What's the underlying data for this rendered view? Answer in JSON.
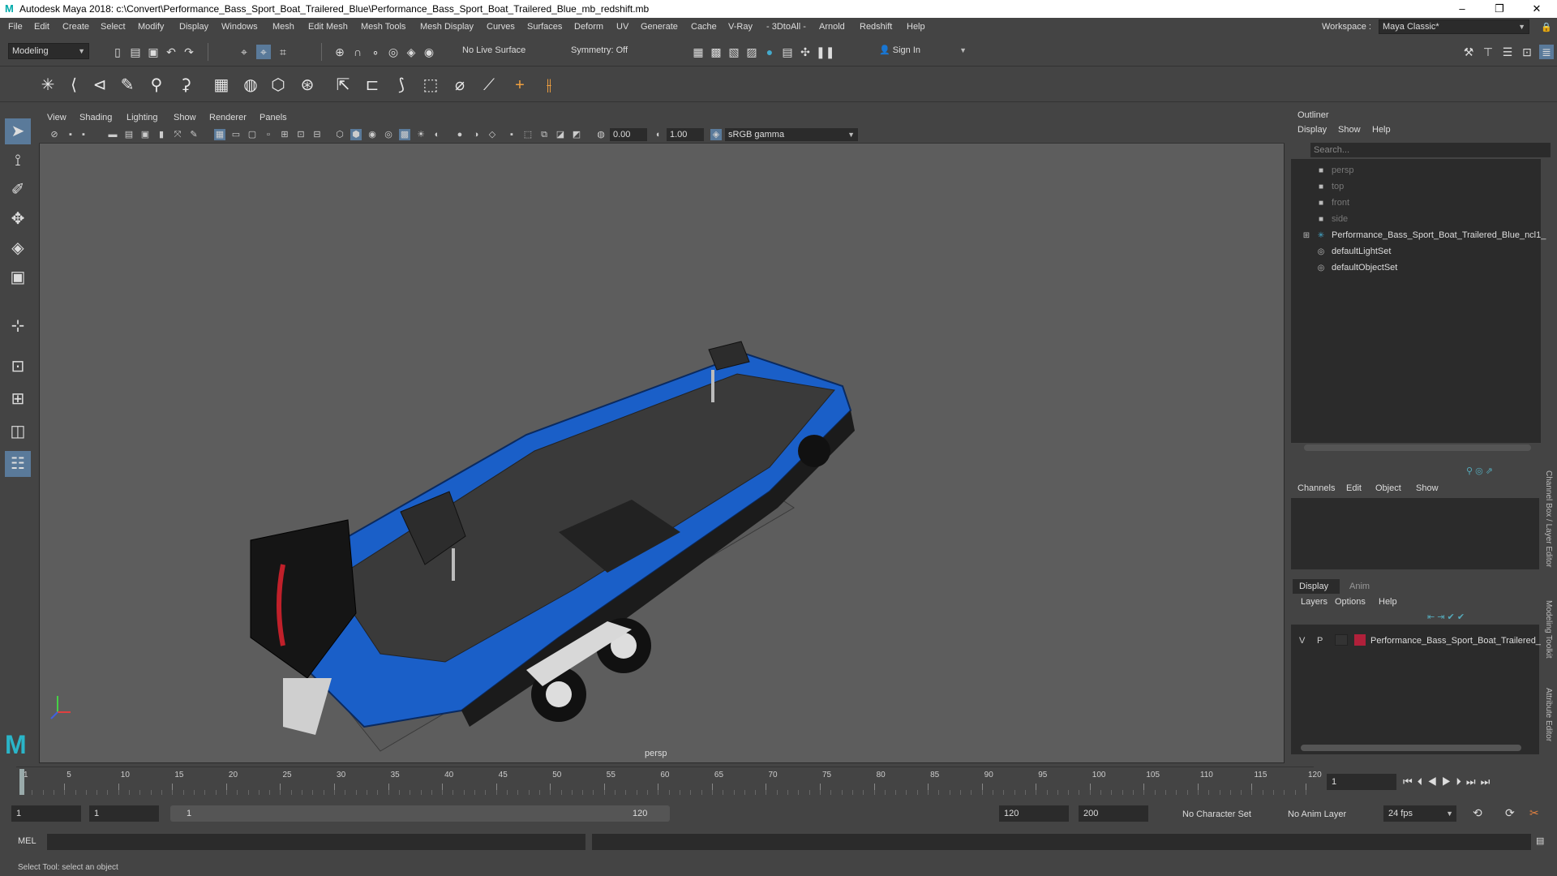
{
  "window": {
    "title": "Autodesk Maya 2018: c:\\Convert\\Performance_Bass_Sport_Boat_Trailered_Blue\\Performance_Bass_Sport_Boat_Trailered_Blue_mb_redshift.mb"
  },
  "menu": [
    "File",
    "Edit",
    "Create",
    "Select",
    "Modify",
    "Display",
    "Windows",
    "Mesh",
    "Edit Mesh",
    "Mesh Tools",
    "Mesh Display",
    "Curves",
    "Surfaces",
    "Deform",
    "UV",
    "Generate",
    "Cache",
    "V-Ray",
    "3DtoAll",
    "Arnold",
    "Redshift",
    "Help"
  ],
  "workspace": {
    "label": "Workspace :",
    "value": "Maya Classic*"
  },
  "toolbar": {
    "mode": "Modeling",
    "live_surface": "No Live Surface",
    "symmetry": "Symmetry: Off",
    "sign_in": "Sign In"
  },
  "viewport": {
    "menu": [
      "View",
      "Shading",
      "Lighting",
      "Show",
      "Renderer",
      "Panels"
    ],
    "exposure": "0.00",
    "gamma": "1.00",
    "color_space": "sRGB gamma",
    "camera_label": "persp"
  },
  "outliner": {
    "title": "Outliner",
    "menu": [
      "Display",
      "Show",
      "Help"
    ],
    "search_placeholder": "Search...",
    "items": [
      {
        "label": "persp",
        "dim": true
      },
      {
        "label": "top",
        "dim": true
      },
      {
        "label": "front",
        "dim": true
      },
      {
        "label": "side",
        "dim": true
      },
      {
        "label": "Performance_Bass_Sport_Boat_Trailered_Blue_ncl1_",
        "dim": false
      },
      {
        "label": "defaultLightSet",
        "dim": false
      },
      {
        "label": "defaultObjectSet",
        "dim": false
      }
    ]
  },
  "channelbox": {
    "menu": [
      "Channels",
      "Edit",
      "Object",
      "Show"
    ]
  },
  "layers": {
    "tabs": [
      "Display",
      "Anim"
    ],
    "menu": [
      "Layers",
      "Options",
      "Help"
    ],
    "row": {
      "v": "V",
      "p": "P",
      "name": "Performance_Bass_Sport_Boat_Trailered_",
      "color": "#b0203a"
    }
  },
  "side_tabs": [
    "Channel Box / Layer Editor",
    "Modeling Toolkit",
    "Attribute Editor"
  ],
  "timeline": {
    "ticks": [
      "1",
      "5",
      "10",
      "15",
      "20",
      "25",
      "30",
      "35",
      "40",
      "45",
      "50",
      "55",
      "60",
      "65",
      "70",
      "75",
      "80",
      "85",
      "90",
      "95",
      "100",
      "105",
      "110",
      "115",
      "120"
    ],
    "current_frame": "1"
  },
  "range": {
    "start": "1",
    "playback_start": "1",
    "slider_start": "1",
    "slider_end": "120",
    "playback_end": "120",
    "end": "200",
    "character_set": "No Character Set",
    "anim_layer": "No Anim Layer",
    "fps": "24 fps"
  },
  "mel": {
    "label": "MEL"
  },
  "status": {
    "text": "Select Tool: select an object"
  },
  "colors": {
    "accent": "#2ab5c8",
    "boat_blue": "#1a5fc8",
    "layer_red": "#b0203a"
  }
}
